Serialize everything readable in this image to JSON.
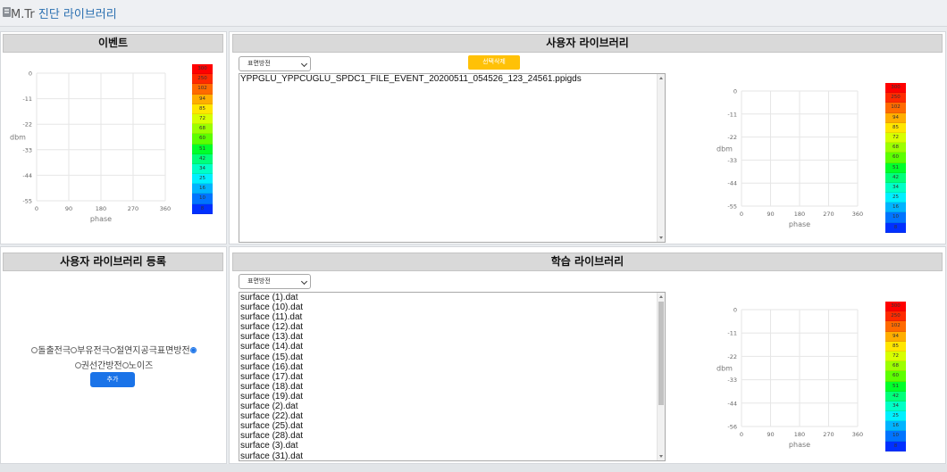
{
  "app": {
    "brand": "M.Tr",
    "title": "진단 라이브러리"
  },
  "event_panel": {
    "title": "이벤트"
  },
  "user_library": {
    "title": "사용자 라이브러리",
    "select_value": "표면방전",
    "delete_button": "선택삭제",
    "files": [
      "YPPGLU_YPPCUGLU_SPDC1_FILE_EVENT_20200511_054526_123_24561.ppigds"
    ]
  },
  "register_panel": {
    "title": "사용자 라이브러리 등록",
    "options": [
      {
        "label": "돌출전극",
        "checked": false
      },
      {
        "label": "부유전극",
        "checked": false
      },
      {
        "label": "절연지공극",
        "checked": false
      },
      {
        "label": "표면방전",
        "checked": true
      },
      {
        "label": "권선간방전",
        "checked": false
      },
      {
        "label": "노이즈",
        "checked": false
      }
    ],
    "add_button": "추가"
  },
  "learning_library": {
    "title": "학습 라이브러리",
    "select_value": "표면방전",
    "files": [
      "surface (1).dat",
      "surface (10).dat",
      "surface (11).dat",
      "surface (12).dat",
      "surface (13).dat",
      "surface (14).dat",
      "surface (15).dat",
      "surface (16).dat",
      "surface (17).dat",
      "surface (18).dat",
      "surface (19).dat",
      "surface (2).dat",
      "surface (22).dat",
      "surface (25).dat",
      "surface (28).dat",
      "surface (3).dat",
      "surface (31).dat"
    ]
  },
  "colorbar": {
    "labels": [
      "300",
      "250",
      "102",
      "94",
      "85",
      "72",
      "68",
      "60",
      "51",
      "42",
      "34",
      "25",
      "16",
      "10",
      "8"
    ],
    "colors": [
      "#ff0000",
      "#ff2a00",
      "#ff6a00",
      "#ffae00",
      "#ffe600",
      "#d7ff00",
      "#9cff00",
      "#5cff00",
      "#00ff2a",
      "#00ff7a",
      "#00ffc6",
      "#00f0ff",
      "#00b4ff",
      "#0074ff",
      "#0030ff"
    ]
  },
  "chart_data": [
    {
      "type": "scatter",
      "xlabel": "phase",
      "ylabel": "dbm",
      "xlim": [
        0,
        360
      ],
      "ylim": [
        -55,
        0
      ],
      "x_ticks": [
        "0",
        "90",
        "180",
        "270",
        "360"
      ],
      "y_ticks": [
        "0",
        "-11",
        "-22",
        "-33",
        "-44",
        "-55"
      ],
      "series": []
    },
    {
      "type": "scatter",
      "xlabel": "phase",
      "ylabel": "dbm",
      "xlim": [
        0,
        360
      ],
      "ylim": [
        -55,
        0
      ],
      "x_ticks": [
        "0",
        "90",
        "180",
        "270",
        "360"
      ],
      "y_ticks": [
        "0",
        "-11",
        "-22",
        "-33",
        "-44",
        "-55"
      ],
      "series": []
    },
    {
      "type": "scatter",
      "xlabel": "phase",
      "ylabel": "dbm",
      "xlim": [
        0,
        360
      ],
      "ylim": [
        -56,
        0
      ],
      "x_ticks": [
        "0",
        "90",
        "180",
        "270",
        "360"
      ],
      "y_ticks": [
        "0",
        "-11",
        "-22",
        "-33",
        "-44",
        "-56"
      ],
      "series": []
    }
  ]
}
